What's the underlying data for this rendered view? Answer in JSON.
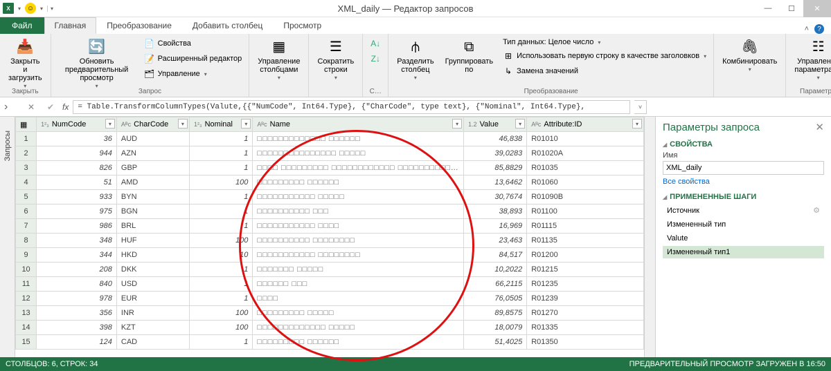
{
  "title": "XML_daily — Редактор запросов",
  "tabs": {
    "file": "Файл",
    "home": "Главная",
    "transform": "Преобразование",
    "addcol": "Добавить столбец",
    "view": "Просмотр"
  },
  "ribbon": {
    "close_load": "Закрыть и\nзагрузить",
    "close_group": "Закрыть",
    "refresh": "Обновить предварительный\nпросмотр",
    "properties": "Свойства",
    "adv_editor": "Расширенный редактор",
    "manage": "Управление",
    "query_group": "Запрос",
    "manage_cols": "Управление\nстолбцами",
    "reduce_rows": "Сократить\nстроки",
    "sort_group": "С…",
    "split_col": "Разделить\nстолбец",
    "group_by": "Группировать\nпо",
    "datatype": "Тип данных: Целое число",
    "first_row": "Использовать первую строку в качестве заголовков",
    "replace": "Замена значений",
    "transform_group": "Преобразование",
    "combine": "Комбинировать",
    "manage_params": "Управление\nпараметрами",
    "params_group": "Параметры"
  },
  "formula": "= Table.TransformColumnTypes(Valute,{{\"NumCode\", Int64.Type}, {\"CharCode\", type text}, {\"Nominal\", Int64.Type},",
  "side_tab": "Запросы",
  "columns": {
    "c1": "NumCode",
    "c2": "CharCode",
    "c3": "Nominal",
    "c4": "Name",
    "c5": "Value",
    "c6": "Attribute:ID"
  },
  "rows": [
    {
      "n": 1,
      "num": "36",
      "code": "AUD",
      "nom": "1",
      "name": "□□□□□□□□□□□□□ □□□□□□",
      "val": "46,838",
      "id": "R01010"
    },
    {
      "n": 2,
      "num": "944",
      "code": "AZN",
      "nom": "1",
      "name": "□□□□□□□□□□□□□□□ □□□□□",
      "val": "39,0283",
      "id": "R01020A"
    },
    {
      "n": 3,
      "num": "826",
      "code": "GBP",
      "nom": "1",
      "name": "□□□□ □□□□□□□□□ □□□□□□□□□□□□ □□□□□□□□□□…",
      "val": "85,8829",
      "id": "R01035"
    },
    {
      "n": 4,
      "num": "51",
      "code": "AMD",
      "nom": "100",
      "name": "□□□□□□□□□ □□□□□□",
      "val": "13,6462",
      "id": "R01060"
    },
    {
      "n": 5,
      "num": "933",
      "code": "BYN",
      "nom": "1",
      "name": "□□□□□□□□□□□ □□□□□",
      "val": "30,7674",
      "id": "R01090B"
    },
    {
      "n": 6,
      "num": "975",
      "code": "BGN",
      "nom": "1",
      "name": "□□□□□□□□□□ □□□",
      "val": "38,893",
      "id": "R01100"
    },
    {
      "n": 7,
      "num": "986",
      "code": "BRL",
      "nom": "1",
      "name": "□□□□□□□□□□□ □□□□",
      "val": "16,969",
      "id": "R01115"
    },
    {
      "n": 8,
      "num": "348",
      "code": "HUF",
      "nom": "100",
      "name": "□□□□□□□□□□ □□□□□□□□",
      "val": "23,463",
      "id": "R01135"
    },
    {
      "n": 9,
      "num": "344",
      "code": "HKD",
      "nom": "10",
      "name": "□□□□□□□□□□□ □□□□□□□□",
      "val": "84,517",
      "id": "R01200"
    },
    {
      "n": 10,
      "num": "208",
      "code": "DKK",
      "nom": "1",
      "name": "□□□□□□□ □□□□□",
      "val": "10,2022",
      "id": "R01215"
    },
    {
      "n": 11,
      "num": "840",
      "code": "USD",
      "nom": "1",
      "name": "□□□□□□ □□□",
      "val": "66,2115",
      "id": "R01235"
    },
    {
      "n": 12,
      "num": "978",
      "code": "EUR",
      "nom": "1",
      "name": "□□□□",
      "val": "76,0505",
      "id": "R01239"
    },
    {
      "n": 13,
      "num": "356",
      "code": "INR",
      "nom": "100",
      "name": "□□□□□□□□□ □□□□□",
      "val": "89,8575",
      "id": "R01270"
    },
    {
      "n": 14,
      "num": "398",
      "code": "KZT",
      "nom": "100",
      "name": "□□□□□□□□□□□□□ □□□□□",
      "val": "18,0079",
      "id": "R01335"
    },
    {
      "n": 15,
      "num": "124",
      "code": "CAD",
      "nom": "1",
      "name": "□□□□□□□□□ □□□□□□",
      "val": "51,4025",
      "id": "R01350"
    }
  ],
  "panel": {
    "title": "Параметры запроса",
    "props": "СВОЙСТВА",
    "name_label": "Имя",
    "name_value": "XML_daily",
    "all_props": "Все свойства",
    "steps_hd": "ПРИМЕНЕННЫЕ ШАГИ",
    "steps": [
      "Источник",
      "Измененный тип",
      "Valute",
      "Измененный тип1"
    ]
  },
  "status": {
    "left": "СТОЛБЦОВ: 6, СТРОК: 34",
    "right": "ПРЕДВАРИТЕЛЬНЫЙ ПРОСМОТР ЗАГРУЖЕН В 16:50"
  }
}
